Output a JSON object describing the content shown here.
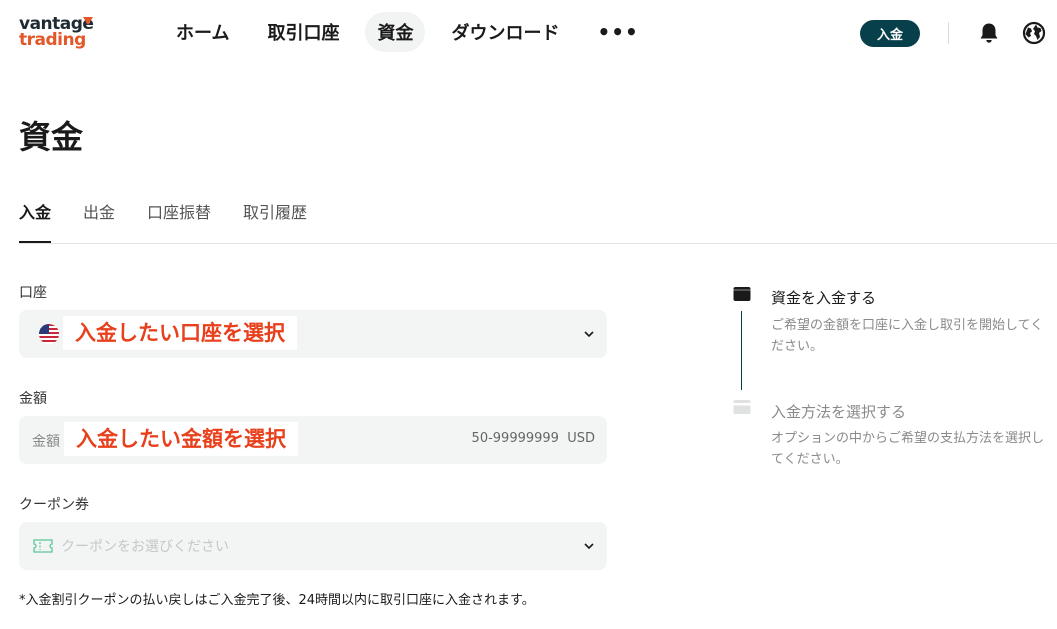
{
  "logo": {
    "line1": "vantage",
    "line2": "trading"
  },
  "nav": {
    "items": [
      "ホーム",
      "取引口座",
      "資金",
      "ダウンロード"
    ],
    "more": "•••"
  },
  "header": {
    "deposit_label": "入金"
  },
  "page": {
    "title": "資金"
  },
  "tabs": [
    "入金",
    "出金",
    "口座振替",
    "取引履歴"
  ],
  "form": {
    "account": {
      "label": "口座",
      "overlay": "入金したい口座を選択"
    },
    "amount": {
      "label": "金額",
      "placeholder": "金額",
      "overlay": "入金したい金額を選択",
      "range": "50-99999999",
      "currency": "USD"
    },
    "coupon": {
      "label": "クーポン券",
      "placeholder": "クーポンをお選びください"
    },
    "note": "*入金割引クーポンの払い戻しはご入金完了後、24時間以内に取引口座に入金されます。"
  },
  "steps": [
    {
      "title": "資金を入金する",
      "desc": "ご希望の金額を口座に入金し取引を開始してください。",
      "active": true
    },
    {
      "title": "入金方法を選択する",
      "desc": "オプションの中からご希望の支払方法を選択してください。",
      "active": false
    }
  ],
  "colors": {
    "accent": "#07404a",
    "brand_orange": "#e35728",
    "annotation_red": "#e8401c",
    "field_bg": "#f3f5f4"
  },
  "icons": {
    "bell": "bell-icon",
    "globe": "globe-icon",
    "wallet": "wallet-icon",
    "card": "card-icon",
    "flag": "us-flag-icon",
    "coupon": "ticket-icon",
    "chevron": "chevron-down-icon"
  }
}
